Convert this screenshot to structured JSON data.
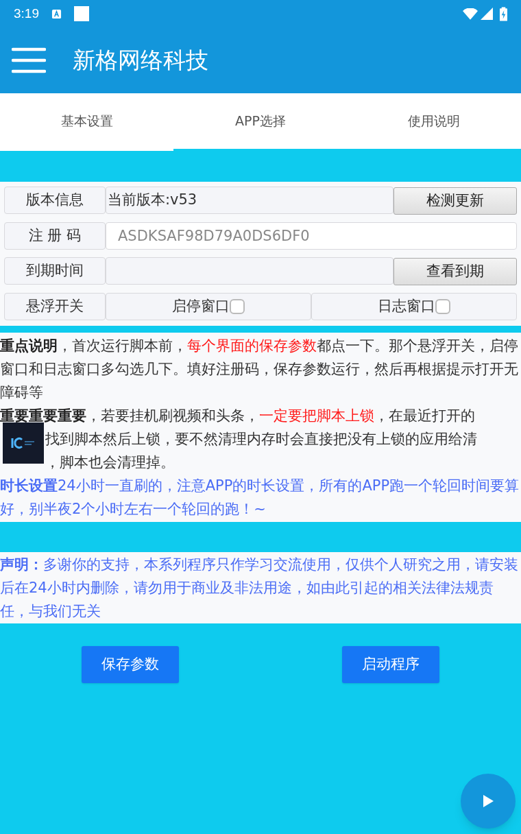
{
  "status_bar": {
    "time": "3:19"
  },
  "app_bar": {
    "title": "新格网络科技"
  },
  "tabs": [
    {
      "label": "基本设置",
      "selected": true
    },
    {
      "label": "APP选择",
      "selected": false
    },
    {
      "label": "使用说明",
      "selected": false
    }
  ],
  "form_rows": [
    {
      "kind": "info",
      "label": "版本信息",
      "value": "当前版本:v53",
      "button": "检测更新"
    },
    {
      "kind": "input",
      "label": "注 册 码",
      "placeholder": "ASDKSAF98D79A0DS6DF0"
    },
    {
      "kind": "info",
      "label": "到期时间",
      "button": "查看到期"
    },
    {
      "kind": "toggles",
      "label": "悬浮开关",
      "options": [
        {
          "label": "启停窗口",
          "checked": false
        },
        {
          "label": "日志窗口",
          "checked": false
        }
      ]
    }
  ],
  "notes": [
    {
      "lines": [
        [
          {
            "kind": "bold",
            "text": "重点说明"
          },
          {
            "kind": "plain",
            "text": "，首次运行脚本前，"
          },
          {
            "kind": "red",
            "text": "每个界面的保存参数"
          },
          {
            "kind": "plain",
            "text": "都点一下。那个悬浮开关，启停窗口和日志窗口多勾选几下。填好注册码，保存参数运行，然后再根据提示打开无障碍等"
          }
        ]
      ]
    },
    {
      "lines": [
        [
          {
            "kind": "bold",
            "text": "重要重要重要"
          },
          {
            "kind": "plain",
            "text": "，若要挂机刷视频和头条，"
          },
          {
            "kind": "red",
            "text": "一定要把脚本上锁"
          },
          {
            "kind": "plain",
            "text": "，在最近打开的"
          }
        ],
        [
          {
            "kind": "plain",
            "text": "找到脚本然后上锁，要不然清理内存时会直接把没有上锁的应用给清"
          }
        ],
        [
          {
            "kind": "plain",
            "text": "，脚本也会清理掉。"
          }
        ]
      ]
    },
    {
      "lines": [
        [
          {
            "kind": "bluebold",
            "text": "时长设置"
          },
          {
            "kind": "blue",
            "text": "24小时一直刷的，注意APP的时长设置，所有的APP跑一个轮回时间要算好，别半夜2个小时左右一个轮回的跑！~"
          }
        ]
      ]
    }
  ],
  "disclaimer": [
    {
      "kind": "bluebold",
      "text": "声明："
    },
    {
      "kind": "blue",
      "text": "多谢你的支持，本系列程序只作学习交流使用，仅供个人研究之用，请安装后在24小时内删除，请勿用于商业及非法用途，如由此引起的相关法律法规责任，与我们无关"
    }
  ],
  "buttons": [
    "保存参数",
    "启动程序"
  ]
}
